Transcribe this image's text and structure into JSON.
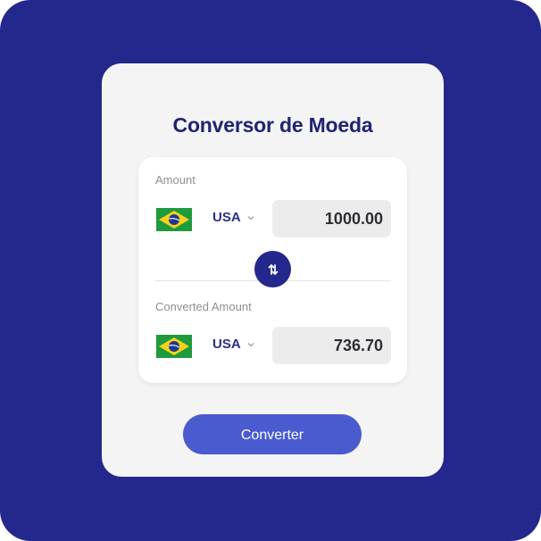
{
  "app": {
    "title": "Conversor de Moeda"
  },
  "from": {
    "label": "Amount",
    "flag_icon": "brazil-flag-icon",
    "currency": "USA",
    "value": "1000.00"
  },
  "to": {
    "label": "Converted Amount",
    "flag_icon": "brazil-flag-icon",
    "currency": "USA",
    "value": "736.70"
  },
  "swap": {
    "icon": "swap-arrows-icon"
  },
  "actions": {
    "convert_label": "Converter"
  },
  "colors": {
    "background": "#24278c",
    "card": "#f4f4f5",
    "panel": "#ffffff",
    "title": "#1f2470",
    "accent_button": "#4a5bd0",
    "swap_button": "#24278c",
    "value_box": "#ececed"
  }
}
